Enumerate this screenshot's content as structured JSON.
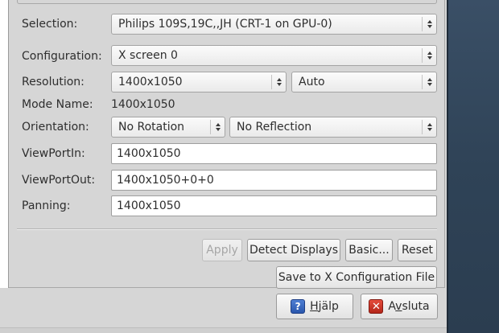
{
  "form": {
    "selection": {
      "label": "Selection:",
      "value": "Philips 109S,19C,,JH (CRT-1 on GPU-0)"
    },
    "configuration": {
      "label": "Configuration:",
      "value": "X screen 0"
    },
    "resolution": {
      "label": "Resolution:",
      "value": "1400x1050",
      "refresh": "Auto"
    },
    "mode_name": {
      "label": "Mode Name:",
      "value": "1400x1050"
    },
    "orientation": {
      "label": "Orientation:",
      "rotation": "No Rotation",
      "reflection": "No Reflection"
    },
    "viewport_in": {
      "label": "ViewPortIn:",
      "value": "1400x1050"
    },
    "viewport_out": {
      "label": "ViewPortOut:",
      "value": "1400x1050+0+0"
    },
    "panning": {
      "label": "Panning:",
      "value": "1400x1050"
    }
  },
  "actions": {
    "apply": "Apply",
    "detect_displays": "Detect Displays",
    "basic": "Basic...",
    "reset": "Reset",
    "save_config": "Save to X Configuration File"
  },
  "footer": {
    "help_prefix": "",
    "help_mnemonic": "H",
    "help_rest": "jälp",
    "quit_prefix": "A",
    "quit_mnemonic": "v",
    "quit_rest": "sluta",
    "help_icon": "help-question-icon",
    "quit_icon": "close-x-icon"
  }
}
